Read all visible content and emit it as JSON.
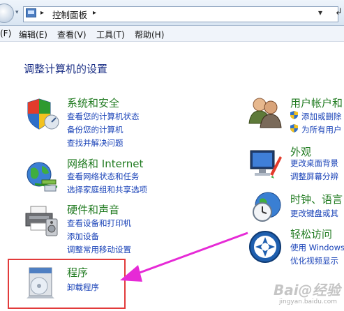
{
  "address_bar": {
    "breadcrumb": "控制面板",
    "nav_dropdown_glyph": "▾",
    "separator_glyph": "▸",
    "refresh_glyph": "↲",
    "forward_glyph": "▾"
  },
  "menubar": {
    "items": [
      "(F)",
      "编辑(E)",
      "查看(V)",
      "工具(T)",
      "帮助(H)"
    ]
  },
  "main": {
    "heading": "调整计算机的设置",
    "categories": [
      {
        "title": "系统和安全",
        "links": [
          "查看您的计算机状态",
          "备份您的计算机",
          "查找并解决问题"
        ]
      },
      {
        "title": "网络和 Internet",
        "links": [
          "查看网络状态和任务",
          "选择家庭组和共享选项"
        ]
      },
      {
        "title": "硬件和声音",
        "links": [
          "查看设备和打印机",
          "添加设备",
          "调整常用移动设置"
        ]
      },
      {
        "title": "程序",
        "links": [
          "卸载程序"
        ]
      },
      {
        "title": "用户帐户和",
        "links": [
          "添加或删除",
          "为所有用户"
        ]
      },
      {
        "title": "外观",
        "links": [
          "更改桌面背景",
          "调整屏幕分辨"
        ]
      },
      {
        "title": "时钟、语言",
        "links": [
          "更改键盘或其"
        ]
      },
      {
        "title": "轻松访问",
        "links": [
          "使用 Windows",
          "优化视频显示"
        ]
      }
    ]
  },
  "watermark": {
    "text": "Bai@经验",
    "url": "jingyan.baidu.com"
  },
  "colors": {
    "category_title": "#1f7a1f",
    "link": "#1a43b8",
    "heading": "#1e3287",
    "highlight": "#e23b3b",
    "arrow": "#e62ad6"
  },
  "icons": [
    "system-security-icon",
    "network-icon",
    "hardware-sound-icon",
    "programs-icon",
    "user-accounts-icon",
    "appearance-icon",
    "clock-language-icon",
    "ease-of-access-icon",
    "uac-shield-icon",
    "control-panel-icon"
  ]
}
